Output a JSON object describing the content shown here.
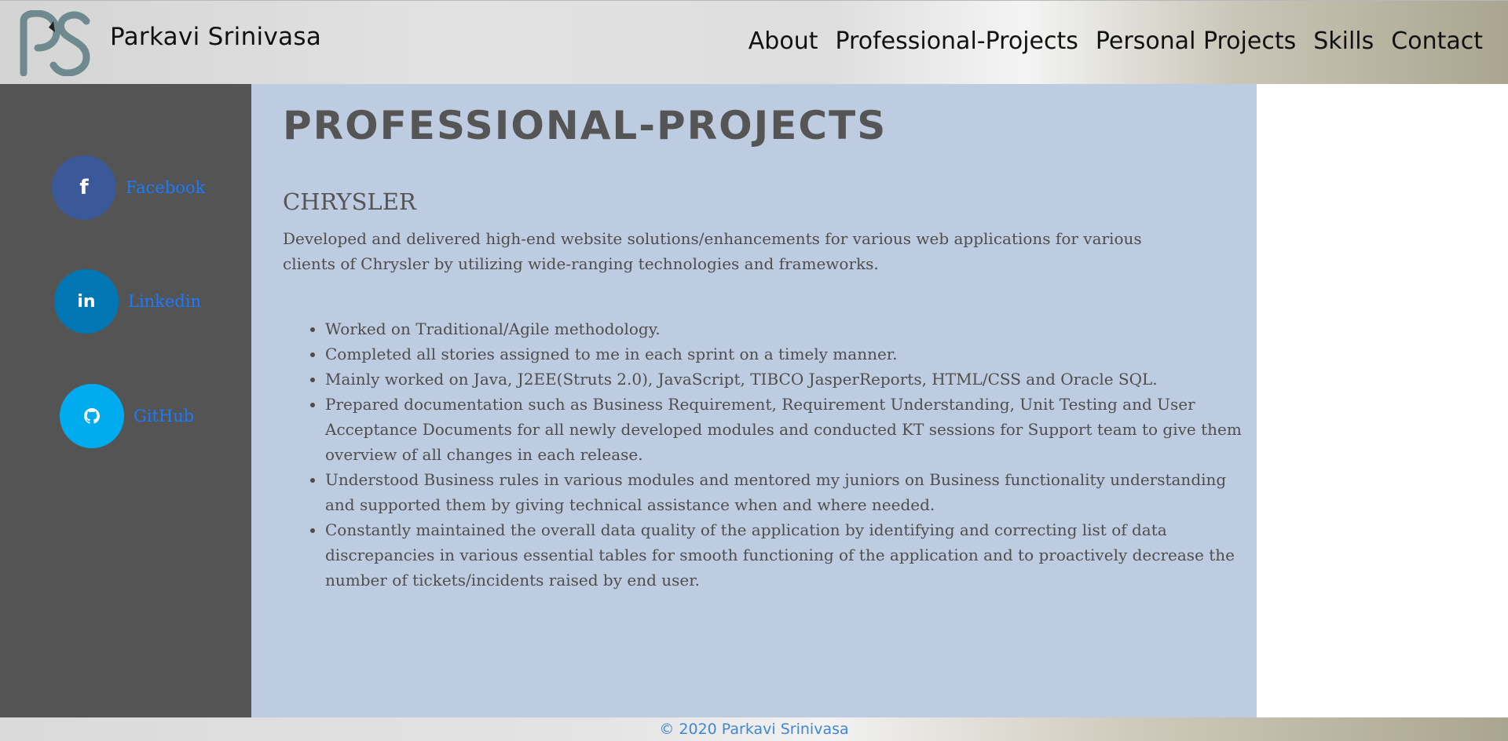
{
  "header": {
    "site_name": "Parkavi Srinivasa",
    "logo_text": "PS",
    "nav": [
      {
        "label": "About"
      },
      {
        "label": "Professional-Projects"
      },
      {
        "label": "Personal Projects"
      },
      {
        "label": "Skills"
      },
      {
        "label": "Contact"
      }
    ]
  },
  "sidebar": {
    "social": [
      {
        "label": "Facebook",
        "icon": "facebook-icon",
        "glyph": "f",
        "color": "#3b5998"
      },
      {
        "label": "Linkedin",
        "icon": "linkedin-icon",
        "glyph": "in",
        "color": "#0077b5"
      },
      {
        "label": "GitHub",
        "icon": "github-icon",
        "glyph": "",
        "color": "#00acee"
      }
    ]
  },
  "main": {
    "page_title": "PROFESSIONAL-PROJECTS",
    "project": {
      "title": "CHRYSLER",
      "description": "Developed and delivered high-end website solutions/enhancements for various web applications for various clients of Chrysler by utilizing wide-ranging technologies and frameworks.",
      "bullets": [
        "Worked on Traditional/Agile methodology.",
        "Completed all stories assigned to me in each sprint on a timely manner.",
        "Mainly worked on Java, J2EE(Struts 2.0), JavaScript, TIBCO JasperReports, HTML/CSS and Oracle SQL.",
        "Prepared documentation such as Business Requirement, Requirement Understanding, Unit Testing and User Acceptance Documents for all newly developed modules and conducted KT sessions for Support team to give them overview of all changes in each release.",
        "Understood Business rules in various modules and mentored my juniors on Business functionality understanding and supported them by giving technical assistance when and where needed.",
        "Constantly maintained the overall data quality of the application by identifying and correcting list of data discrepancies in various essential tables for smooth functioning of the application and to proactively decrease the number of tickets/incidents raised by end user."
      ]
    }
  },
  "footer": {
    "text": "© 2020 Parkavi Srinivasa"
  },
  "colors": {
    "sidebar_bg": "#545454",
    "main_bg": "#bdcce0",
    "link": "#1a7bff",
    "footer_text": "#3f87d4"
  }
}
